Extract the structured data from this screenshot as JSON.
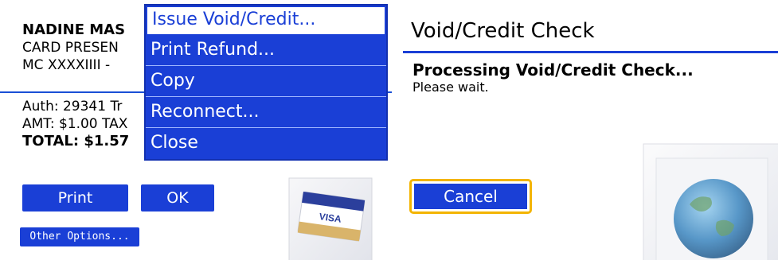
{
  "left_screen": {
    "receipt": {
      "name": "NADINE MAS",
      "card_line": "CARD PRESEN",
      "masked": "MC XXXXIIII -",
      "auth": "Auth: 29341  Tr",
      "amount": "AMT: $1.00 TAX",
      "total": "TOTAL: $1.57"
    },
    "menu": {
      "items": [
        "Issue Void/Credit...",
        "Print Refund...",
        "Copy",
        "Reconnect...",
        "Close"
      ],
      "selected_index": 0
    },
    "buttons": {
      "print": "Print",
      "ok": "OK",
      "other_options": "Other Options..."
    },
    "card_image_text": "VISA"
  },
  "right_screen": {
    "title": "Void/Credit Check",
    "processing": "Processing Void/Credit Check...",
    "wait": "Please wait.",
    "cancel": "Cancel"
  },
  "colors": {
    "accent_blue": "#1a3fd6",
    "focus_yellow": "#f3b400"
  }
}
